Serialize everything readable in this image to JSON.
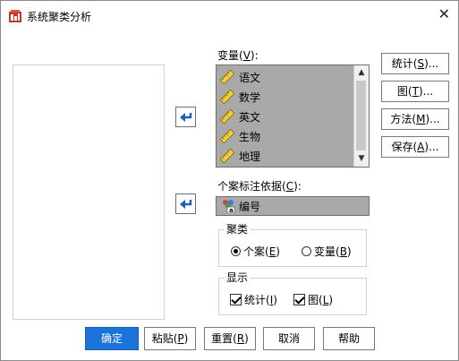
{
  "window": {
    "title": "系统聚类分析",
    "close_glyph": "✕"
  },
  "variables": {
    "label_prefix": "变量(",
    "label_key": "V",
    "label_suffix": "):",
    "items": [
      {
        "label": "语文",
        "icon": "ruler-icon"
      },
      {
        "label": "数学",
        "icon": "ruler-icon"
      },
      {
        "label": "英文",
        "icon": "ruler-icon"
      },
      {
        "label": "生物",
        "icon": "ruler-icon"
      },
      {
        "label": "地理",
        "icon": "ruler-icon"
      }
    ]
  },
  "case_label": {
    "label_prefix": "个案标注依据(",
    "label_key": "C",
    "label_suffix": "):",
    "value": "编号",
    "icon": "nominal-string-icon"
  },
  "side_buttons": {
    "stats": {
      "text": "统计(",
      "key": "S",
      "tail": ")..."
    },
    "plots": {
      "text": "图(",
      "key": "T",
      "tail": ")..."
    },
    "method": {
      "text": "方法(",
      "key": "M",
      "tail": ")..."
    },
    "save": {
      "text": "保存(",
      "key": "A",
      "tail": ")..."
    }
  },
  "cluster_group": {
    "title": "聚类",
    "case": {
      "text": "个案(",
      "key": "E",
      "tail": ")",
      "selected": true
    },
    "variable": {
      "text": "变量(",
      "key": "B",
      "tail": ")",
      "selected": false
    }
  },
  "display_group": {
    "title": "显示",
    "stats": {
      "text": "统计(",
      "key": "I",
      "tail": ")",
      "checked": true
    },
    "plots": {
      "text": "图(",
      "key": "L",
      "tail": ")",
      "checked": true
    }
  },
  "bottom_buttons": {
    "ok": "确定",
    "paste": {
      "text": "粘贴(",
      "key": "P",
      "tail": ")"
    },
    "reset": {
      "text": "重置(",
      "key": "R",
      "tail": ")"
    },
    "cancel": "取消",
    "help": "帮助"
  },
  "colors": {
    "primary": "#1a73d9",
    "list_bg": "#a9a9a9",
    "arrow": "#1a5fb4"
  }
}
